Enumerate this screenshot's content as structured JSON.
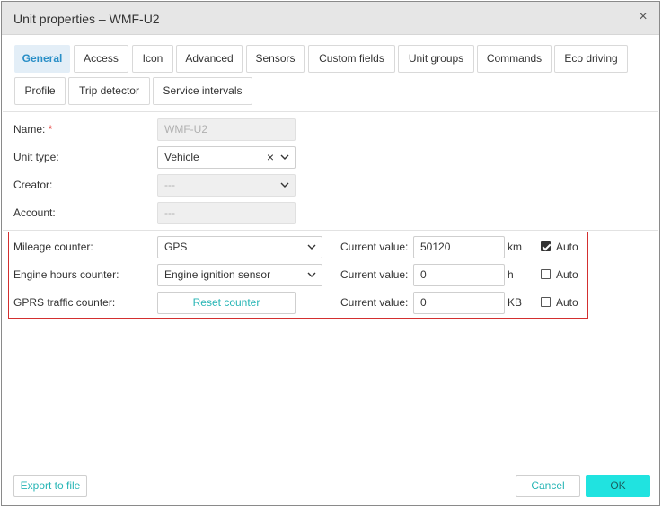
{
  "window": {
    "title": "Unit properties – WMF-U2",
    "close_glyph": "×"
  },
  "tabs": [
    {
      "label": "General",
      "active": true
    },
    {
      "label": "Access"
    },
    {
      "label": "Icon"
    },
    {
      "label": "Advanced"
    },
    {
      "label": "Sensors"
    },
    {
      "label": "Custom fields"
    },
    {
      "label": "Unit groups"
    },
    {
      "label": "Commands"
    },
    {
      "label": "Eco driving"
    },
    {
      "label": "Profile"
    },
    {
      "label": "Trip detector"
    },
    {
      "label": "Service intervals"
    }
  ],
  "general": {
    "name_label": "Name:",
    "required_mark": "*",
    "name_value": "WMF-U2",
    "unit_type_label": "Unit type:",
    "unit_type_value": "Vehicle",
    "creator_label": "Creator:",
    "creator_value": "---",
    "account_label": "Account:",
    "account_value": "---"
  },
  "counters": {
    "mileage_label": "Mileage counter:",
    "mileage_value": "GPS",
    "engine_label": "Engine hours counter:",
    "engine_value": "Engine ignition sensor",
    "gprs_label": "GPRS traffic counter:",
    "reset_label": "Reset counter",
    "current_value_label": "Current value:",
    "mileage_current": "50120",
    "mileage_unit": "km",
    "engine_current": "0",
    "engine_unit": "h",
    "gprs_current": "0",
    "gprs_unit": "KB",
    "auto_label": "Auto",
    "mileage_auto": true,
    "engine_auto": false,
    "gprs_auto": false
  },
  "footer": {
    "export_label": "Export to file",
    "cancel_label": "Cancel",
    "ok_label": "OK"
  },
  "colors": {
    "accent": "#26b5b5",
    "primary_button": "#20e3e0",
    "active_tab": "#e3eef7",
    "highlight_border": "#d32f2f"
  }
}
